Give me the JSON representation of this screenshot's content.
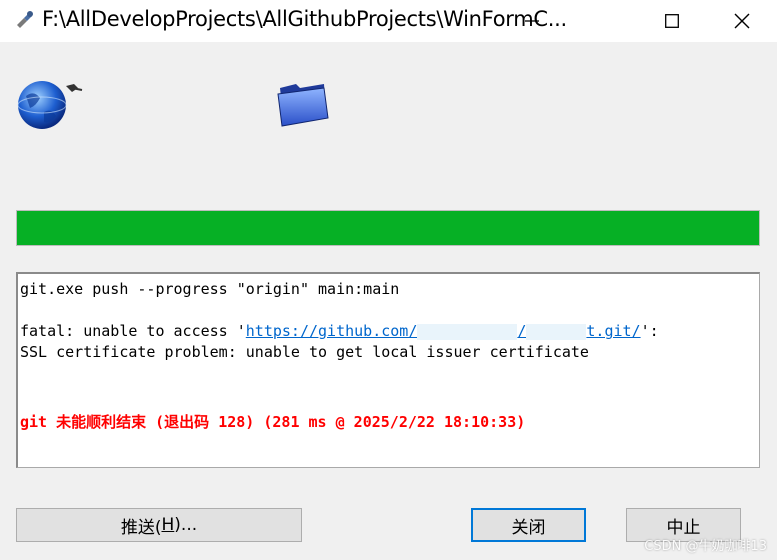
{
  "window": {
    "title": "F:\\AllDevelopProjects\\AllGithubProjects\\WinFormC...",
    "icon": "tortoisegit-icon"
  },
  "progress": {
    "percent": 100,
    "color": "#06b025"
  },
  "log": {
    "command": "git.exe push --progress \"origin\" main:main",
    "fatal_prefix": "fatal: unable to access '",
    "url_start": "https://github.com/",
    "url_mid": "/",
    "url_end": "t.git/",
    "fatal_suffix": "':",
    "ssl_error": "SSL certificate problem: unable to get local issuer certificate",
    "result": "git 未能顺利结束 (退出码 128) (281 ms @ 2025/2/22 18:10:33)"
  },
  "buttons": {
    "push_prefix": "推送(",
    "push_key": "H",
    "push_suffix": ")...",
    "close": "关闭",
    "abort": "中止"
  },
  "watermark": "CSDN @牛奶咖啡13",
  "colors": {
    "error": "#ff0000",
    "link": "#0066cc",
    "accent": "#0078d7"
  }
}
